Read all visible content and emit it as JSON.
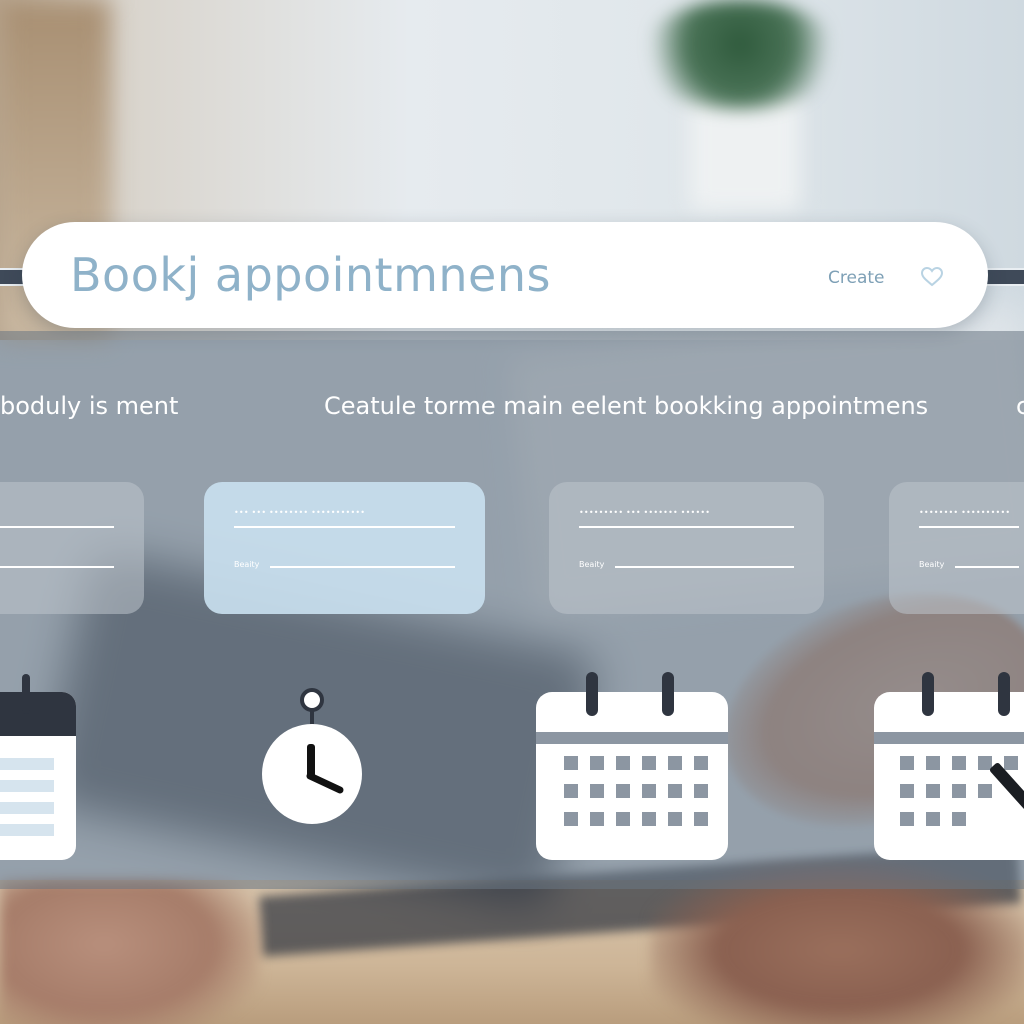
{
  "header": {
    "title": "Bookj appointmnens",
    "create_label": "Create"
  },
  "panel": {
    "left_text": "boduly is ment",
    "center_text": "Ceatule torme main eelent bookking appointmens",
    "right_text": "c"
  },
  "cards": [
    {
      "line1": "",
      "line2": ""
    },
    {
      "line1": "••• ••• •••••••• •••••••••••",
      "line2": "Beaity"
    },
    {
      "line1": "••••••••• ••• ••••••• ••••••",
      "line2": "Beaity"
    },
    {
      "line1": "•••••••• ••••••••••",
      "line2": "Beaity"
    }
  ],
  "icons": [
    "calendar-icon",
    "clock-icon",
    "calendar-icon",
    "calendar-edit-icon"
  ],
  "colors": {
    "accent": "#8fb2c9",
    "panel": "#69768a",
    "active_card": "#c8deee",
    "icon_dark": "#2f3540"
  }
}
